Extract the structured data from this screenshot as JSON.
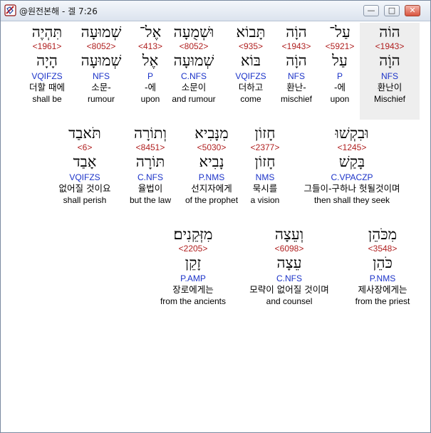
{
  "window": {
    "title": "@원전본해 - 겔 7:26",
    "buttons": {
      "minimize": "—",
      "maximize": "□",
      "close": "✕"
    }
  },
  "rows": [
    [
      {
        "hebrew": "הוֹה",
        "strong": "<1943>",
        "lemma": "הוָֹה",
        "parse": "NFS",
        "korean": "환난이",
        "english": "Mischief",
        "selected": true
      },
      {
        "hebrew": "עַל־",
        "strong": "<5921>",
        "lemma": "עַל",
        "parse": "P",
        "korean": "-에",
        "english": "upon"
      },
      {
        "hebrew": "הוָֹה",
        "strong": "<1943>",
        "lemma": "הוָֹה",
        "parse": "NFS",
        "korean": "환난-",
        "english": "mischief"
      },
      {
        "hebrew": "תָּבוֹא",
        "strong": "<935>",
        "lemma": "בּוֹא",
        "parse": "VQIFZS",
        "korean": "더하고",
        "english": "come"
      },
      {
        "hebrew": "וּשְׁמֻעָה",
        "strong": "<8052>",
        "lemma": "שְׁמוּעָה",
        "parse": "C.NFS",
        "korean": "소문이",
        "english": "and rumour"
      },
      {
        "hebrew": "אֶל־",
        "strong": "<413>",
        "lemma": "אֶל",
        "parse": "P",
        "korean": "-에",
        "english": "upon"
      },
      {
        "hebrew": "שְׁמוּעָה",
        "strong": "<8052>",
        "lemma": "שְׁמוּעָה",
        "parse": "NFS",
        "korean": "소문-",
        "english": "rumour"
      },
      {
        "hebrew": "תִּהְיֶה",
        "strong": "<1961>",
        "lemma": "הָיָה",
        "parse": "VQIFZS",
        "korean": "더할 때에",
        "english": "shall be"
      }
    ],
    [
      {
        "hebrew": "וּבִקְשׁוּ",
        "strong": "<1245>",
        "lemma": "בָּקַשׁ",
        "parse": "C.VPACZP",
        "korean": "그들이-구하나 헛될것이며",
        "english": "then shall they seek"
      },
      {
        "hebrew": "חָזוֹן",
        "strong": "<2377>",
        "lemma": "חָזוֹן",
        "parse": "NMS",
        "korean": "묵시를",
        "english": "a vision"
      },
      {
        "hebrew": "מִנָּבִיא",
        "strong": "<5030>",
        "lemma": "נָבִיא",
        "parse": "P.NMS",
        "korean": "선지자에게",
        "english": "of the prophet"
      },
      {
        "hebrew": "וְתוֹרָה",
        "strong": "<8451>",
        "lemma": "תּוֹרָה",
        "parse": "C.NFS",
        "korean": "율법이",
        "english": "but the law"
      },
      {
        "hebrew": "תֹּאבַד",
        "strong": "<6>",
        "lemma": "אָבַד",
        "parse": "VQIFZS",
        "korean": "없어질 것이요",
        "english": "shall perish"
      }
    ],
    [
      {
        "hebrew": "מִכֹּהֵן",
        "strong": "<3548>",
        "lemma": "כֹּהֵן",
        "parse": "P.NMS",
        "korean": "제사장에게는",
        "english": "from the priest"
      },
      {
        "hebrew": "וְעֵצָה",
        "strong": "<6098>",
        "lemma": "עֵצָה",
        "parse": "C.NFS",
        "korean": "모략이 없어질 것이며",
        "english": "and counsel"
      },
      {
        "hebrew": "מִזְּקֵנִים׃",
        "strong": "<2205>",
        "lemma": "זָקֵן",
        "parse": "P.AMP",
        "korean": "장로에게는",
        "english": "from the ancients"
      }
    ]
  ]
}
